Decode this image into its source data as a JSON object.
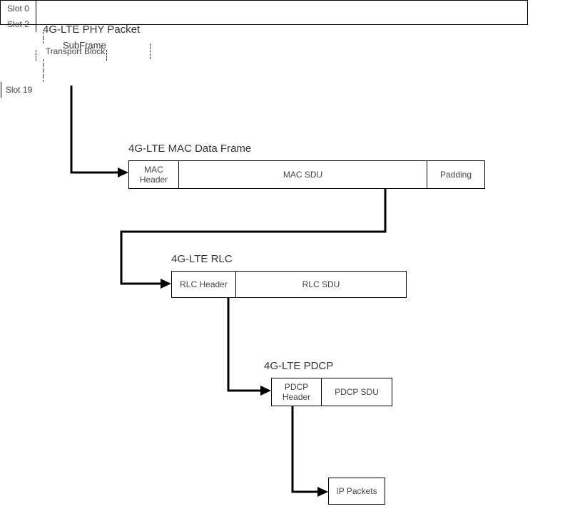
{
  "phy": {
    "title": "4G-LTE PHY  Packet",
    "subframe_label": "SubFrame",
    "slot0": "Slot 0",
    "slot2": "Slot 2",
    "transport_block": "Transport Block",
    "slot19": "Slot 19"
  },
  "mac": {
    "title": "4G-LTE MAC Data Frame",
    "header": "MAC Header",
    "sdu": "MAC SDU",
    "padding": "Padding"
  },
  "rlc": {
    "title": "4G-LTE RLC",
    "header": "RLC Header",
    "sdu": "RLC SDU"
  },
  "pdcp": {
    "title": "4G-LTE PDCP",
    "header": "PDCP Header",
    "sdu": "PDCP SDU"
  },
  "ip": {
    "label": "IP Packets"
  }
}
